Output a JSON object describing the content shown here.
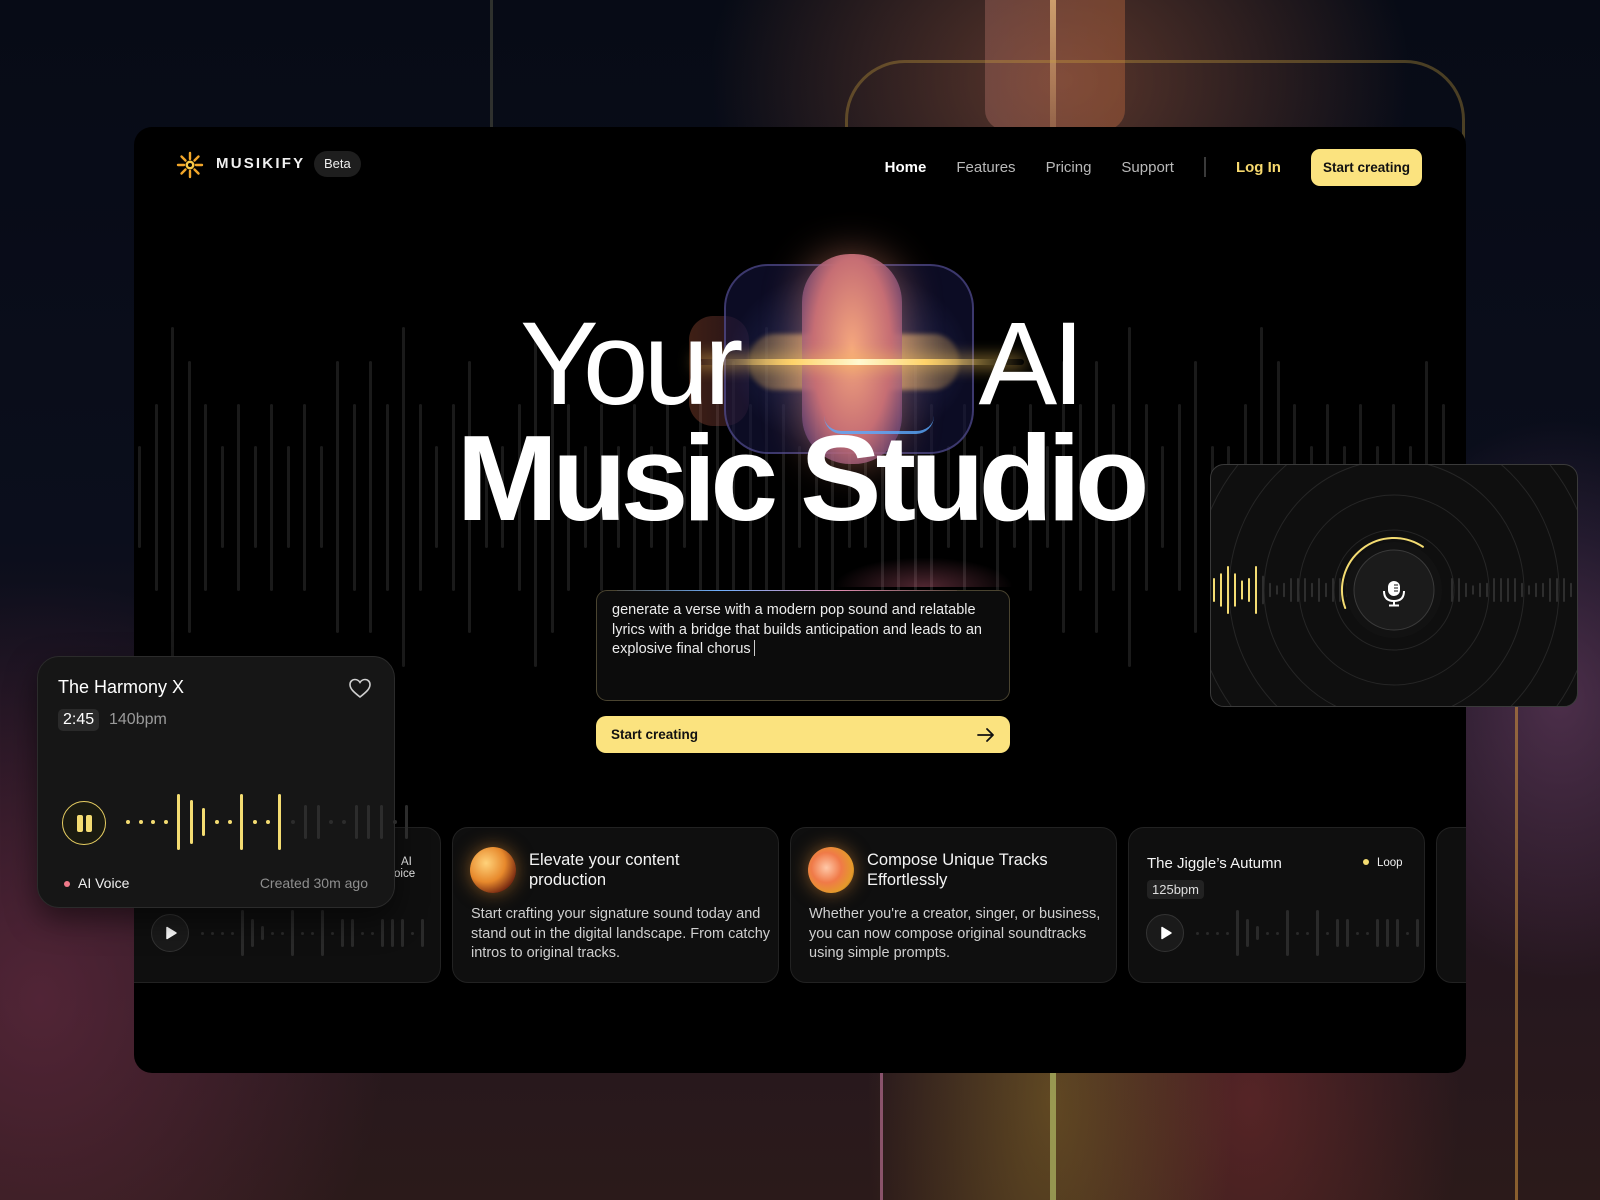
{
  "brand": {
    "name": "MUSIKIFY",
    "badge": "Beta",
    "logo_icon": "sunburst-icon"
  },
  "nav": {
    "links": [
      {
        "label": "Home",
        "active": true
      },
      {
        "label": "Features",
        "active": false
      },
      {
        "label": "Pricing",
        "active": false
      },
      {
        "label": "Support",
        "active": false
      }
    ],
    "login": "Log In",
    "cta": "Start creating"
  },
  "hero": {
    "line1_left": "Your",
    "line1_right": "AI",
    "line2": "Music Studio"
  },
  "prompt": {
    "value": "generate a verse with a modern pop sound and relatable lyrics with a bridge that builds anticipation and leads to an explosive final chorus",
    "button_label": "Start creating",
    "button_icon": "arrow-right-icon"
  },
  "cards": [
    {
      "type": "track",
      "tag": "AI Voice",
      "icon": "play-icon"
    },
    {
      "type": "feature",
      "title": "Elevate your content production",
      "description": "Start crafting your signature sound today and stand out in the digital landscape. From catchy intros to original tracks."
    },
    {
      "type": "feature",
      "title": "Compose Unique Tracks Effortlessly",
      "description": "Whether you're a creator, singer, or business, you can now compose original soundtracks using simple prompts."
    },
    {
      "type": "track",
      "title": "The Jiggle’s Autumn",
      "tag": "Loop",
      "bpm": "125bpm",
      "icon": "play-icon"
    }
  ],
  "player": {
    "title": "The Harmony X",
    "duration": "2:45",
    "bpm": "140bpm",
    "voice_tag": "AI Voice",
    "created": "Created 30m ago",
    "progress": 0.55,
    "state": "playing"
  },
  "mic_widget": {
    "icon": "microphone-icon",
    "progress": 0.4
  },
  "colors": {
    "accent": "#fbe37f",
    "accent_text": "#f7d96e",
    "voice_dot": "#f07a8a",
    "loop_dot": "#f4dc72",
    "window_bg": "#000000",
    "card_bg": "#0f0f0f"
  }
}
